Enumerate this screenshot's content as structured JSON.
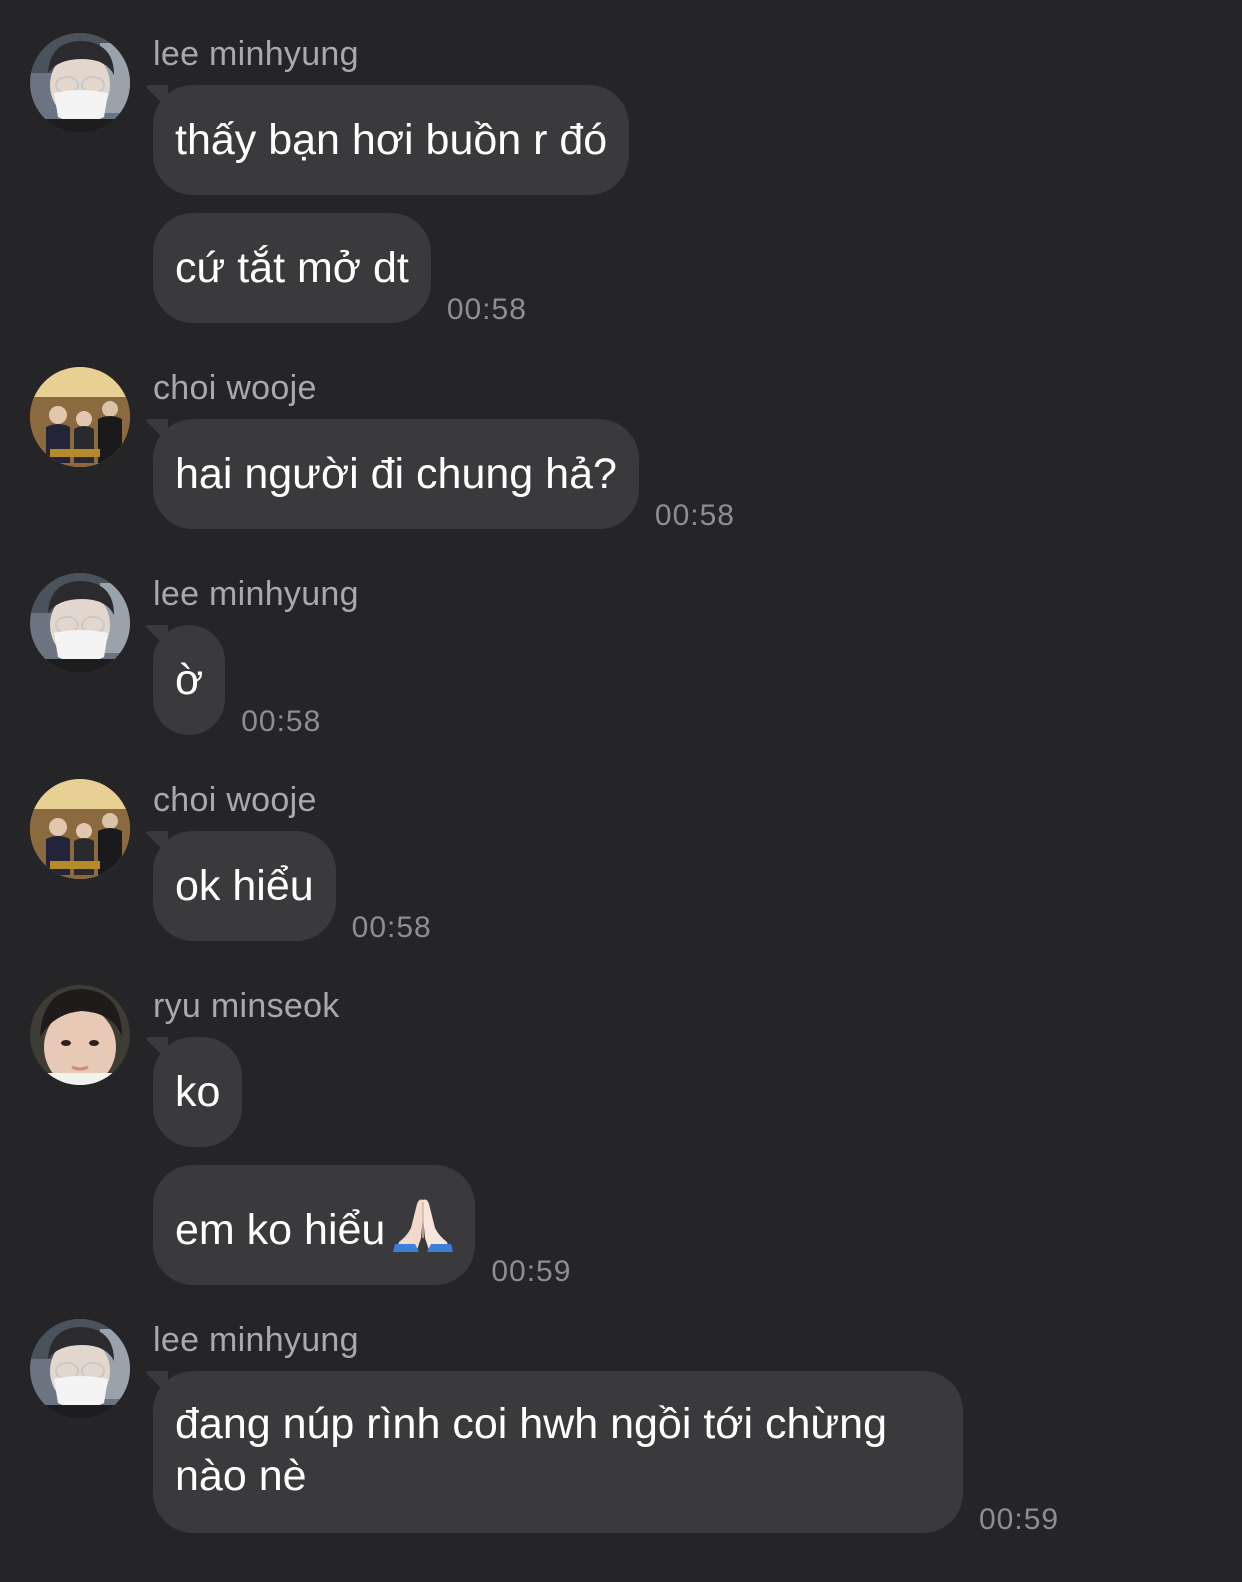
{
  "conversation": [
    {
      "sender": "lee minhyung",
      "avatar": "lee-minhyung-avatar",
      "messages": [
        {
          "text": "thấy bạn hơi buồn r đó",
          "time": ""
        },
        {
          "text": "cứ tắt mở dt",
          "time": "00:58"
        }
      ]
    },
    {
      "sender": "choi wooje",
      "avatar": "choi-wooje-avatar",
      "messages": [
        {
          "text": "hai người đi chung hả?",
          "time": "00:58"
        }
      ]
    },
    {
      "sender": "lee minhyung",
      "avatar": "lee-minhyung-avatar",
      "messages": [
        {
          "text": "ờ",
          "time": "00:58"
        }
      ]
    },
    {
      "sender": "choi wooje",
      "avatar": "choi-wooje-avatar",
      "messages": [
        {
          "text": "ok hiểu",
          "time": "00:58"
        }
      ]
    },
    {
      "sender": "ryu minseok",
      "avatar": "ryu-minseok-avatar",
      "messages": [
        {
          "text": "ko",
          "time": ""
        },
        {
          "text": "em ko hiểu",
          "emoji": "folded-hands-icon",
          "time": "00:59"
        }
      ]
    },
    {
      "sender": "lee minhyung",
      "avatar": "lee-minhyung-avatar",
      "messages": [
        {
          "text": "đang núp rình coi hwh ngồi tới chừng nào nè",
          "time": "00:59"
        }
      ]
    }
  ],
  "colors": {
    "background": "#252528",
    "bubble": "#3a3a3d",
    "sender_text": "#a9a9ad",
    "time_text": "#8d8d92"
  }
}
